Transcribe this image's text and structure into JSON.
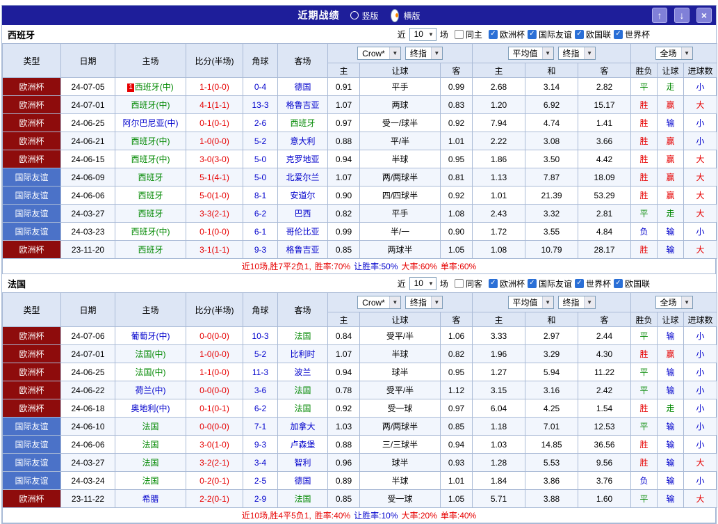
{
  "colors": {
    "topbar": "#1e1e9a",
    "green": "#008800",
    "red": "#e60000",
    "navy": "#0000cc",
    "headerbg": "#dde6f5",
    "grid": "#a9bad6",
    "rowalt": "#f2f6fd",
    "orange": "#ff8a00",
    "btn": "#8080d8",
    "btnborder": "#b2b2ee",
    "maroon": "#8e0c0c",
    "compblue": "#4b72c8"
  },
  "type_colors": {
    "欧洲杯": "#8e0c0c",
    "国际友谊": "#4b72c8"
  },
  "topbar": {
    "title": "近期战绩",
    "radios": [
      {
        "label": "竖版",
        "selected": false
      },
      {
        "label": "横版",
        "selected": true
      }
    ],
    "buttons": [
      {
        "name": "scroll-up-button",
        "glyph": "↑"
      },
      {
        "name": "scroll-down-button",
        "glyph": "↓"
      },
      {
        "name": "close-button",
        "glyph": "×"
      }
    ]
  },
  "header": {
    "cols": [
      "类型",
      "日期",
      "主场",
      "比分(半场)",
      "角球",
      "客场"
    ],
    "subs": [
      "主",
      "让球",
      "客",
      "主",
      "和",
      "客",
      "胜负",
      "让球",
      "进球数"
    ],
    "dd": {
      "book": "Crow*",
      "final1": "终指",
      "avg": "平均值",
      "final2": "终指",
      "scope": "全场"
    }
  },
  "sections": [
    {
      "name": "西班牙",
      "filter": {
        "near": "近",
        "count": "10",
        "games": "场",
        "same": "同主",
        "comps": [
          "欧洲杯",
          "国际友谊",
          "欧国联",
          "世界杯"
        ]
      },
      "rows": [
        {
          "type": "欧洲杯",
          "date": "24-07-05",
          "home": "西班牙(中)",
          "home_badge": "1",
          "score": "1-1(0-0)",
          "corner": "0-4",
          "away": "德国",
          "asian": [
            "0.91",
            "平手",
            "0.99"
          ],
          "euro": [
            "2.68",
            "3.14",
            "2.82"
          ],
          "results": [
            "平",
            "走",
            "小"
          ]
        },
        {
          "type": "欧洲杯",
          "date": "24-07-01",
          "home": "西班牙(中)",
          "score": "4-1(1-1)",
          "corner": "13-3",
          "away": "格鲁吉亚",
          "asian": [
            "1.07",
            "两球",
            "0.83"
          ],
          "euro": [
            "1.20",
            "6.92",
            "15.17"
          ],
          "results": [
            "胜",
            "赢",
            "大"
          ]
        },
        {
          "type": "欧洲杯",
          "date": "24-06-25",
          "home": "阿尔巴尼亚(中)",
          "score": "0-1(0-1)",
          "corner": "2-6",
          "away": "西班牙",
          "asian": [
            "0.97",
            "受一/球半",
            "0.92"
          ],
          "euro": [
            "7.94",
            "4.74",
            "1.41"
          ],
          "results": [
            "胜",
            "输",
            "小"
          ]
        },
        {
          "type": "欧洲杯",
          "date": "24-06-21",
          "home": "西班牙(中)",
          "score": "1-0(0-0)",
          "corner": "5-2",
          "away": "意大利",
          "asian": [
            "0.88",
            "平/半",
            "1.01"
          ],
          "euro": [
            "2.22",
            "3.08",
            "3.66"
          ],
          "results": [
            "胜",
            "赢",
            "小"
          ]
        },
        {
          "type": "欧洲杯",
          "date": "24-06-15",
          "home": "西班牙(中)",
          "score": "3-0(3-0)",
          "corner": "5-0",
          "away": "克罗地亚",
          "asian": [
            "0.94",
            "半球",
            "0.95"
          ],
          "euro": [
            "1.86",
            "3.50",
            "4.42"
          ],
          "results": [
            "胜",
            "赢",
            "大"
          ]
        },
        {
          "type": "国际友谊",
          "date": "24-06-09",
          "home": "西班牙",
          "score": "5-1(4-1)",
          "corner": "5-0",
          "away": "北爱尔兰",
          "asian": [
            "1.07",
            "两/两球半",
            "0.81"
          ],
          "euro": [
            "1.13",
            "7.87",
            "18.09"
          ],
          "results": [
            "胜",
            "赢",
            "大"
          ]
        },
        {
          "type": "国际友谊",
          "date": "24-06-06",
          "home": "西班牙",
          "score": "5-0(1-0)",
          "corner": "8-1",
          "away": "安道尔",
          "asian": [
            "0.90",
            "四/四球半",
            "0.92"
          ],
          "euro": [
            "1.01",
            "21.39",
            "53.29"
          ],
          "results": [
            "胜",
            "赢",
            "大"
          ]
        },
        {
          "type": "国际友谊",
          "date": "24-03-27",
          "home": "西班牙",
          "score": "3-3(2-1)",
          "corner": "6-2",
          "away": "巴西",
          "asian": [
            "0.82",
            "平手",
            "1.08"
          ],
          "euro": [
            "2.43",
            "3.32",
            "2.81"
          ],
          "results": [
            "平",
            "走",
            "大"
          ]
        },
        {
          "type": "国际友谊",
          "date": "24-03-23",
          "home": "西班牙(中)",
          "score": "0-1(0-0)",
          "corner": "6-1",
          "away": "哥伦比亚",
          "asian": [
            "0.99",
            "半/一",
            "0.90"
          ],
          "euro": [
            "1.72",
            "3.55",
            "4.84"
          ],
          "results": [
            "负",
            "输",
            "小"
          ]
        },
        {
          "type": "欧洲杯",
          "date": "23-11-20",
          "home": "西班牙",
          "score": "3-1(1-1)",
          "corner": "9-3",
          "away": "格鲁吉亚",
          "asian": [
            "0.85",
            "两球半",
            "1.05"
          ],
          "euro": [
            "1.08",
            "10.79",
            "28.17"
          ],
          "results": [
            "胜",
            "输",
            "大"
          ]
        }
      ],
      "summary": [
        {
          "text": "近10场,胜7平2负1,",
          "color": "red"
        },
        {
          "text": "胜率:70%",
          "color": "red"
        },
        {
          "text": "让胜率:50%",
          "color": "navy"
        },
        {
          "text": "大率:60%",
          "color": "red"
        },
        {
          "text": "单率:60%",
          "color": "red"
        }
      ]
    },
    {
      "name": "法国",
      "filter": {
        "near": "近",
        "count": "10",
        "games": "场",
        "same": "同客",
        "comps": [
          "欧洲杯",
          "国际友谊",
          "世界杯",
          "欧国联"
        ]
      },
      "rows": [
        {
          "type": "欧洲杯",
          "date": "24-07-06",
          "home": "葡萄牙(中)",
          "score": "0-0(0-0)",
          "corner": "10-3",
          "away": "法国",
          "asian": [
            "0.84",
            "受平/半",
            "1.06"
          ],
          "euro": [
            "3.33",
            "2.97",
            "2.44"
          ],
          "results": [
            "平",
            "输",
            "小"
          ]
        },
        {
          "type": "欧洲杯",
          "date": "24-07-01",
          "home": "法国(中)",
          "score": "1-0(0-0)",
          "corner": "5-2",
          "away": "比利时",
          "asian": [
            "1.07",
            "半球",
            "0.82"
          ],
          "euro": [
            "1.96",
            "3.29",
            "4.30"
          ],
          "results": [
            "胜",
            "赢",
            "小"
          ]
        },
        {
          "type": "欧洲杯",
          "date": "24-06-25",
          "home": "法国(中)",
          "score": "1-1(0-0)",
          "corner": "11-3",
          "away": "波兰",
          "asian": [
            "0.94",
            "球半",
            "0.95"
          ],
          "euro": [
            "1.27",
            "5.94",
            "11.22"
          ],
          "results": [
            "平",
            "输",
            "小"
          ]
        },
        {
          "type": "欧洲杯",
          "date": "24-06-22",
          "home": "荷兰(中)",
          "score": "0-0(0-0)",
          "corner": "3-6",
          "away": "法国",
          "asian": [
            "0.78",
            "受平/半",
            "1.12"
          ],
          "euro": [
            "3.15",
            "3.16",
            "2.42"
          ],
          "results": [
            "平",
            "输",
            "小"
          ]
        },
        {
          "type": "欧洲杯",
          "date": "24-06-18",
          "home": "奥地利(中)",
          "score": "0-1(0-1)",
          "corner": "6-2",
          "away": "法国",
          "asian": [
            "0.92",
            "受一球",
            "0.97"
          ],
          "euro": [
            "6.04",
            "4.25",
            "1.54"
          ],
          "results": [
            "胜",
            "走",
            "小"
          ]
        },
        {
          "type": "国际友谊",
          "date": "24-06-10",
          "home": "法国",
          "score": "0-0(0-0)",
          "corner": "7-1",
          "away": "加拿大",
          "asian": [
            "1.03",
            "两/两球半",
            "0.85"
          ],
          "euro": [
            "1.18",
            "7.01",
            "12.53"
          ],
          "results": [
            "平",
            "输",
            "小"
          ]
        },
        {
          "type": "国际友谊",
          "date": "24-06-06",
          "home": "法国",
          "score": "3-0(1-0)",
          "corner": "9-3",
          "away": "卢森堡",
          "asian": [
            "0.88",
            "三/三球半",
            "0.94"
          ],
          "euro": [
            "1.03",
            "14.85",
            "36.56"
          ],
          "results": [
            "胜",
            "输",
            "小"
          ]
        },
        {
          "type": "国际友谊",
          "date": "24-03-27",
          "home": "法国",
          "score": "3-2(2-1)",
          "corner": "3-4",
          "away": "智利",
          "asian": [
            "0.96",
            "球半",
            "0.93"
          ],
          "euro": [
            "1.28",
            "5.53",
            "9.56"
          ],
          "results": [
            "胜",
            "输",
            "大"
          ]
        },
        {
          "type": "国际友谊",
          "date": "24-03-24",
          "home": "法国",
          "score": "0-2(0-1)",
          "corner": "2-5",
          "away": "德国",
          "asian": [
            "0.89",
            "半球",
            "1.01"
          ],
          "euro": [
            "1.84",
            "3.86",
            "3.76"
          ],
          "results": [
            "负",
            "输",
            "小"
          ]
        },
        {
          "type": "欧洲杯",
          "date": "23-11-22",
          "home": "希腊",
          "score": "2-2(0-1)",
          "corner": "2-9",
          "away": "法国",
          "asian": [
            "0.85",
            "受一球",
            "1.05"
          ],
          "euro": [
            "5.71",
            "3.88",
            "1.60"
          ],
          "results": [
            "平",
            "输",
            "大"
          ]
        }
      ],
      "summary": [
        {
          "text": "近10场,胜4平5负1,",
          "color": "red"
        },
        {
          "text": "胜率:40%",
          "color": "red"
        },
        {
          "text": "让胜率:10%",
          "color": "navy"
        },
        {
          "text": "大率:20%",
          "color": "red"
        },
        {
          "text": "单率:40%",
          "color": "red"
        }
      ]
    }
  ]
}
